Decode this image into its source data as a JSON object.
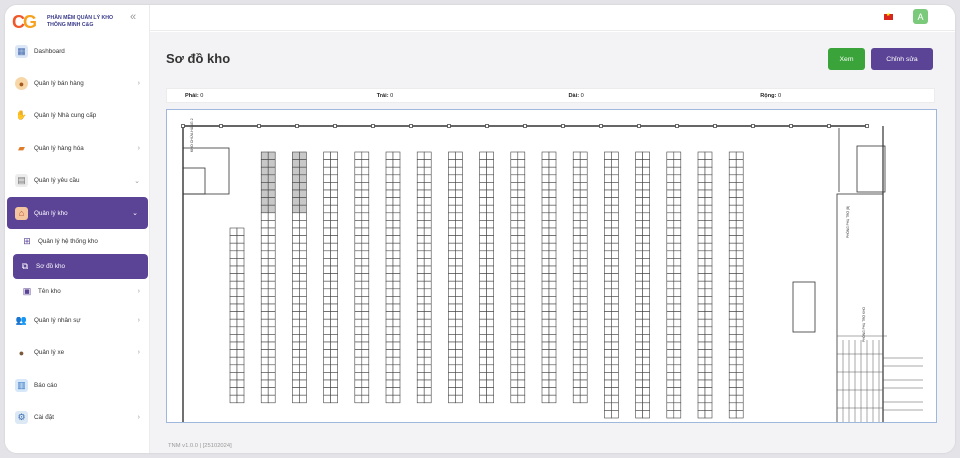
{
  "brand": {
    "logo_text": "CG",
    "name_line1": "PHẦN MỀM QUẢN LÝ KHO",
    "name_line2": "THÔNG MINH C&G"
  },
  "sidebar": {
    "collapse_icon": "double-chevron-left-icon",
    "items": [
      {
        "label": "Dashboard",
        "icon": "dashboard-icon"
      },
      {
        "label": "Quản lý bán hàng",
        "icon": "sales-icon"
      },
      {
        "label": "Quản lý Nhà cung cấp",
        "icon": "supplier-icon"
      },
      {
        "label": "Quản lý hàng hóa",
        "icon": "goods-icon"
      },
      {
        "label": "Quản lý yêu cầu",
        "icon": "request-icon"
      },
      {
        "label": "Quản lý kho",
        "icon": "warehouse-icon"
      },
      {
        "label": "Quản lý nhân sự",
        "icon": "staff-icon"
      },
      {
        "label": "Quản lý xe",
        "icon": "vehicle-icon"
      },
      {
        "label": "Báo cáo",
        "icon": "report-icon"
      },
      {
        "label": "Cài đặt",
        "icon": "settings-icon"
      }
    ],
    "subitems": [
      {
        "label": "Quản lý hệ thống kho",
        "icon": "grid-icon"
      },
      {
        "label": "Sơ đồ kho",
        "icon": "map-icon"
      },
      {
        "label": "Tên kho",
        "icon": "box-icon"
      }
    ]
  },
  "topbar": {
    "avatar": "A",
    "flag": "vietnam-flag-icon"
  },
  "page": {
    "title": "Sơ đồ kho",
    "view_button": "Xem",
    "edit_button": "Chỉnh sửa",
    "dims": {
      "right_label": "Phải:",
      "right_value": "0",
      "left_label": "Trái:",
      "left_value": "0",
      "length_label": "Dài:",
      "length_value": "0",
      "width_label": "Rộng:",
      "width_value": "0"
    }
  },
  "floorplan": {
    "office_label": "KHO CHỨA HÀNG 2",
    "room_label_1": "PHÒNG PHỤ TRỢ (B)",
    "room_label_2": "PHÒNG PHỤ TRỢ KHO",
    "rack_count": 17
  },
  "footer": {
    "version": "TNM v1.0.0 | [25102024]"
  },
  "colors": {
    "accent": "#5b4396",
    "green": "#3aa33a"
  }
}
